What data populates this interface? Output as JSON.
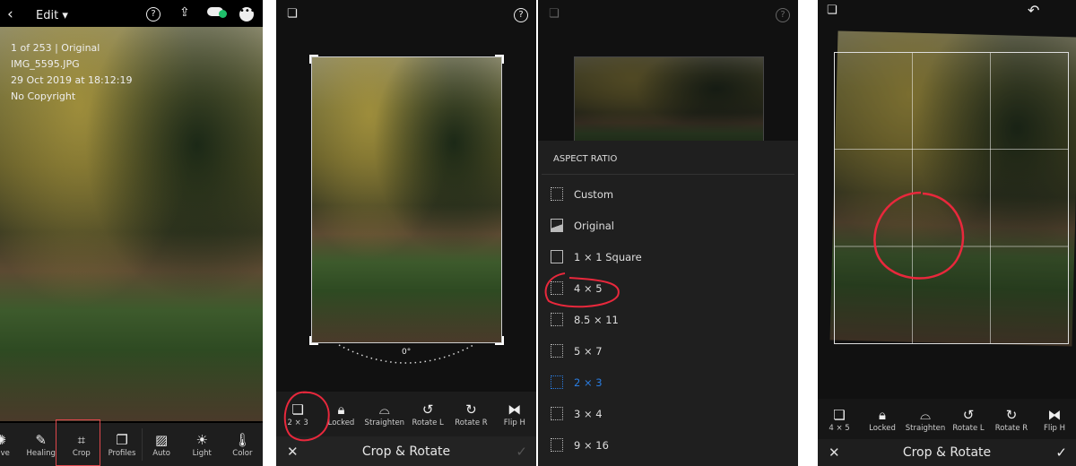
{
  "panel1": {
    "header": {
      "back": "back-icon",
      "title": "Edit",
      "icons": [
        "help-icon",
        "share-icon",
        "cloud-sync-icon",
        "more-icon"
      ],
      "sync_color": "#1fbf6a"
    },
    "info": [
      "1 of 253 | Original",
      "IMG_5595.JPG",
      "29 Oct 2019 at 18:12:19",
      "No Copyright"
    ],
    "toolbar": [
      {
        "label": "ctive",
        "icon": "selective-icon"
      },
      {
        "label": "Healing",
        "icon": "healing-icon"
      },
      {
        "label": "Crop",
        "icon": "crop-icon",
        "highlighted": true
      },
      {
        "label": "Profiles",
        "icon": "profiles-icon"
      },
      {
        "label": "Auto",
        "icon": "auto-icon"
      },
      {
        "label": "Light",
        "icon": "light-icon"
      },
      {
        "label": "Color",
        "icon": "color-icon"
      }
    ],
    "highlight_color": "#e0474c"
  },
  "panel2": {
    "angle": "0°",
    "toolbar": [
      {
        "label": "2 × 3",
        "icon": "aspect-icon"
      },
      {
        "label": "Locked",
        "icon": "lock-icon"
      },
      {
        "label": "Straighten",
        "icon": "straighten-icon"
      },
      {
        "label": "Rotate L",
        "icon": "rotate-left-icon"
      },
      {
        "label": "Rotate R",
        "icon": "rotate-right-icon"
      },
      {
        "label": "Flip H",
        "icon": "flip-icon"
      }
    ],
    "title": "Crop & Rotate"
  },
  "panel3": {
    "heading": "ASPECT RATIO",
    "items": [
      "Custom",
      "Original",
      "1 × 1  Square",
      "4 × 5",
      "8.5 × 11",
      "5 × 7",
      "2 × 3",
      "3 × 4",
      "9 × 16"
    ],
    "selected": "2 × 3",
    "accent": "#2a7de1"
  },
  "panel4": {
    "toolbar": [
      {
        "label": "4 × 5",
        "icon": "aspect-icon"
      },
      {
        "label": "Locked",
        "icon": "lock-icon"
      },
      {
        "label": "Straighten",
        "icon": "straighten-icon"
      },
      {
        "label": "Rotate L",
        "icon": "rotate-left-icon"
      },
      {
        "label": "Rotate R",
        "icon": "rotate-right-icon"
      },
      {
        "label": "Flip H",
        "icon": "flip-icon"
      }
    ],
    "title": "Crop & Rotate"
  },
  "annotation_color": "#e8283c"
}
